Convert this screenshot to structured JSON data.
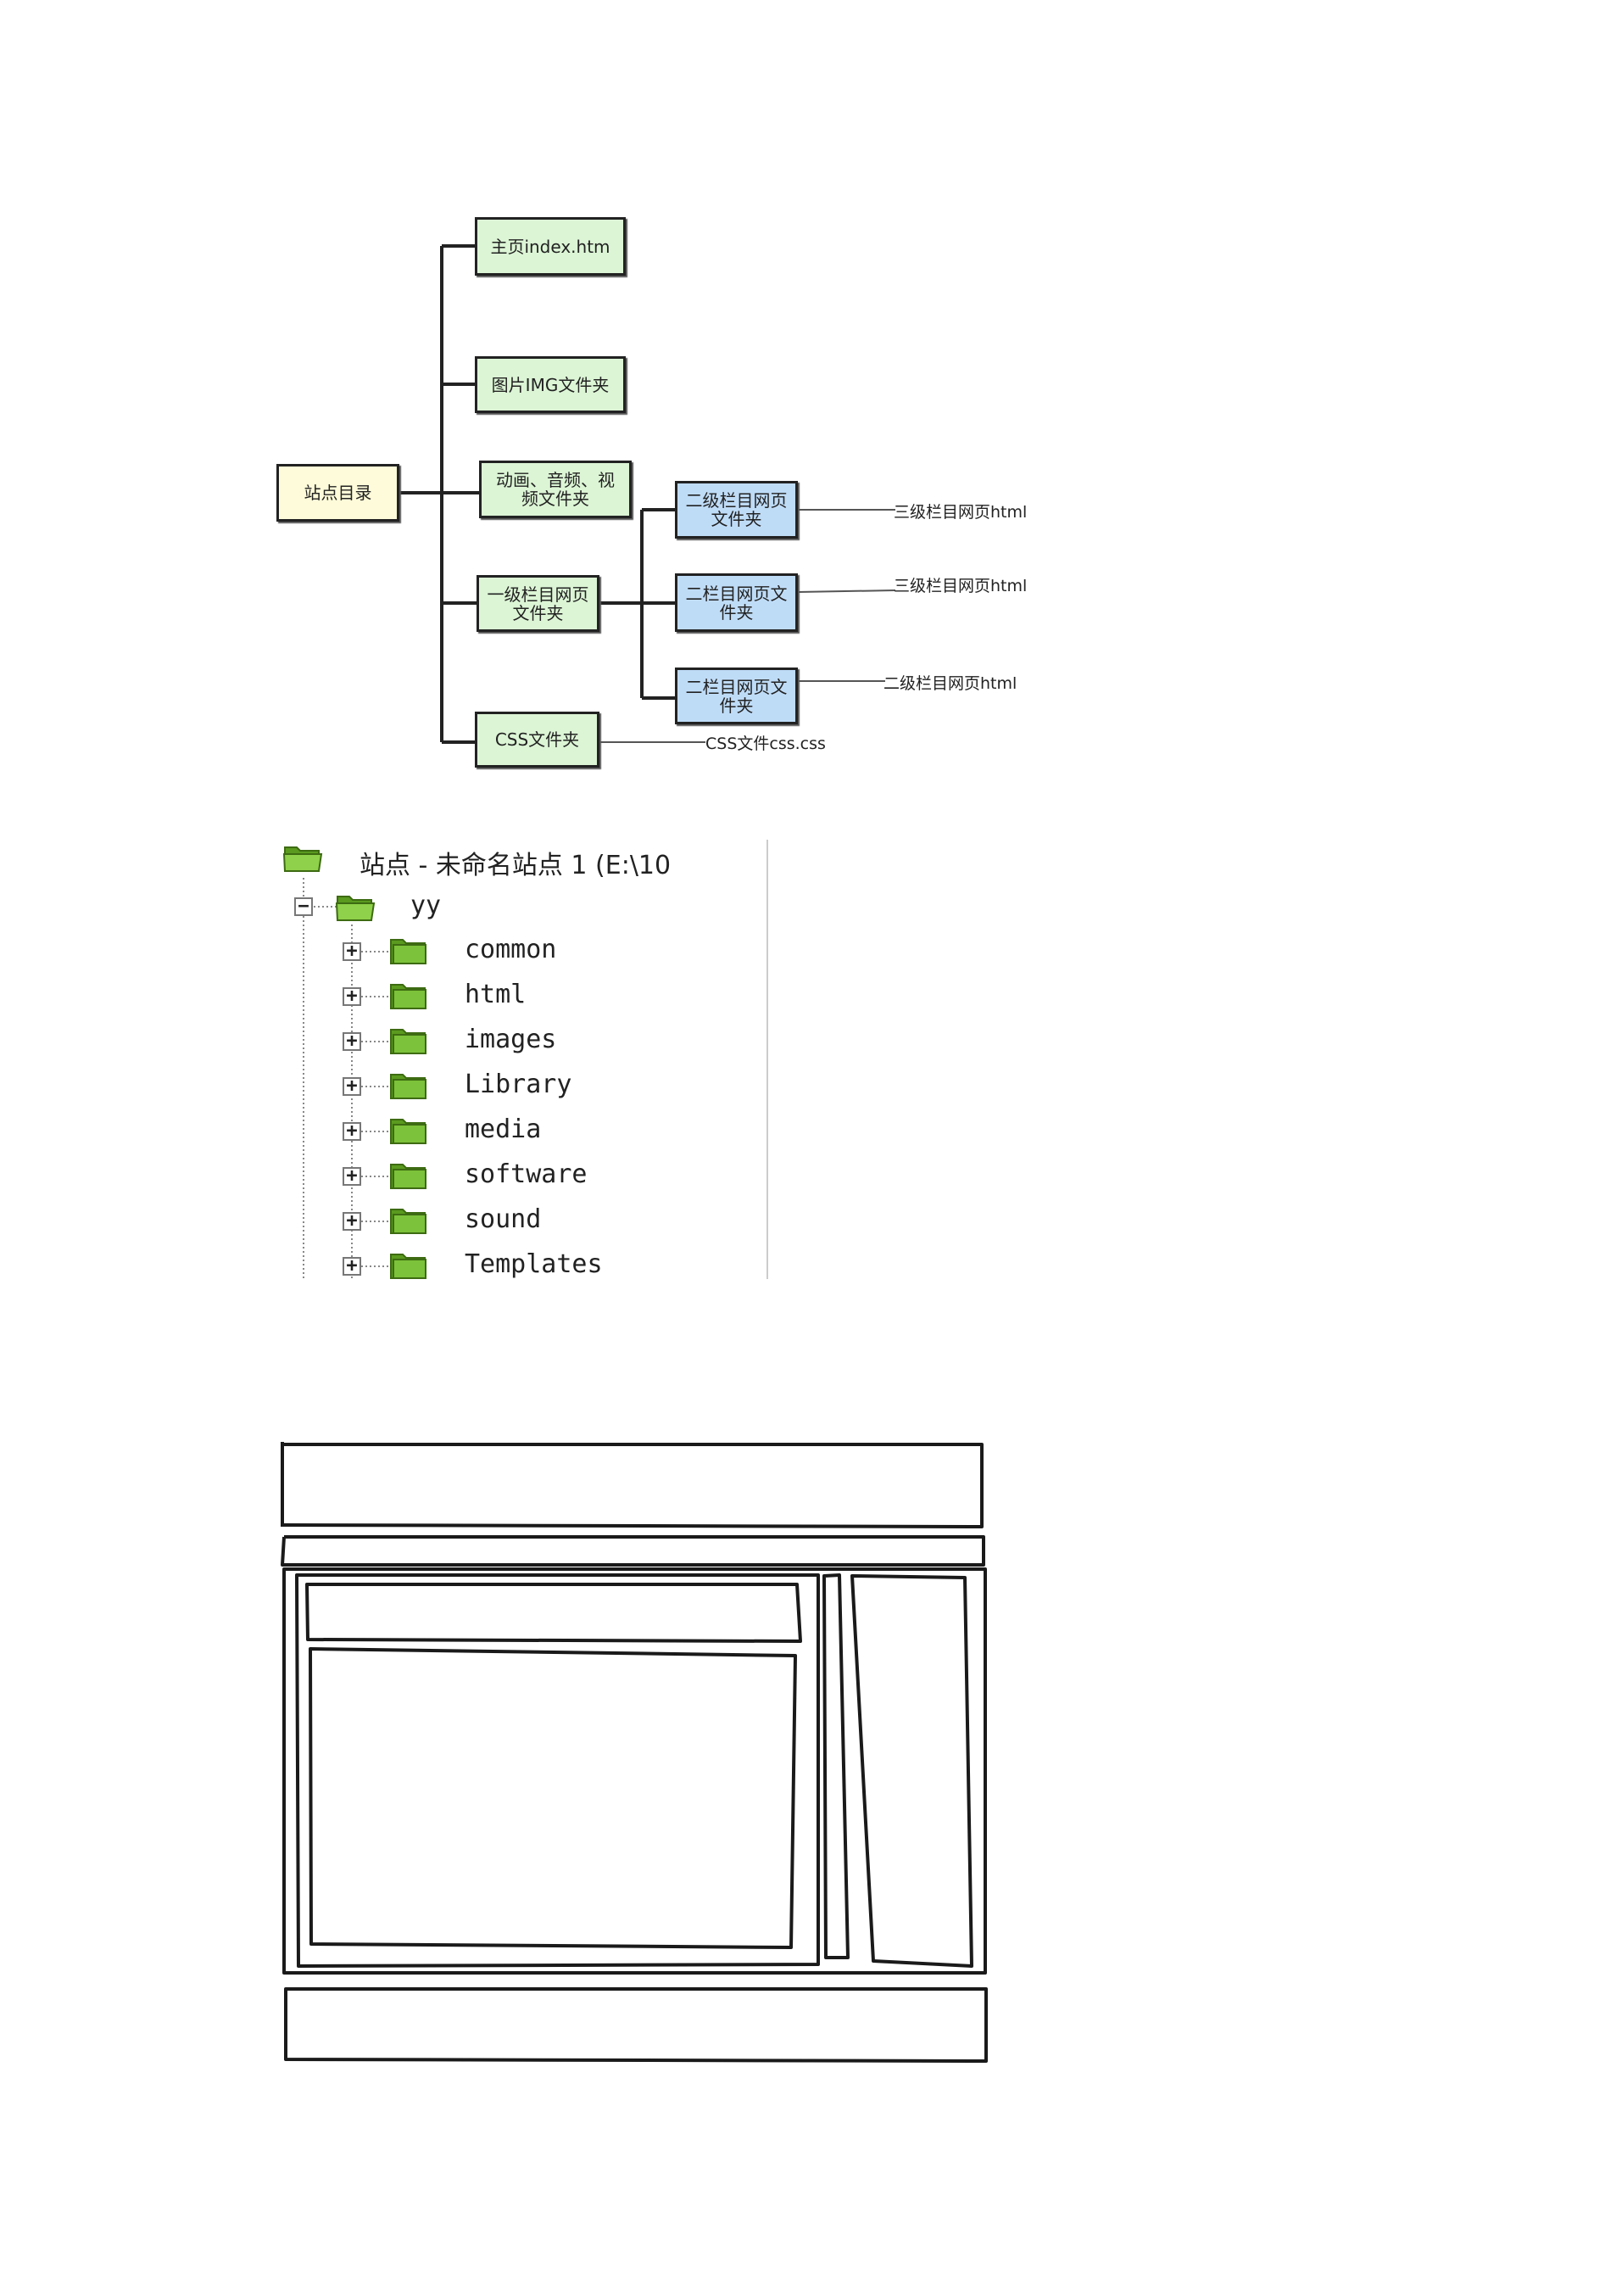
{
  "diagram": {
    "root": "站点目录",
    "level1": [
      "主页index.htm",
      "图片IMG文件夹",
      "动画、音频、视频文件夹",
      "一级栏目网页文件夹",
      "CSS文件夹"
    ],
    "level2": [
      "二级栏目网页文件夹",
      "二栏目网页文件夹",
      "二栏目网页文件夹"
    ],
    "level3": [
      "三级栏目网页html",
      "三级栏目网页html",
      "二级栏目网页html"
    ],
    "css_file": "CSS文件css.css",
    "colors": {
      "root": "#fdfbd9",
      "level1": "#dcf5d5",
      "level2": "#bfdcf7"
    }
  },
  "tree": {
    "title": "站点 - 未命名站点 1 (E:\\10",
    "root_folder": "yy",
    "folders": [
      "common",
      "html",
      "images",
      "Library",
      "media",
      "software",
      "sound",
      "Templates"
    ],
    "folder_color": "#7cc23a"
  },
  "sketch": {
    "regions": [
      "header",
      "nav",
      "main-banner",
      "main-content",
      "narrow-column",
      "sidebar",
      "footer"
    ]
  }
}
